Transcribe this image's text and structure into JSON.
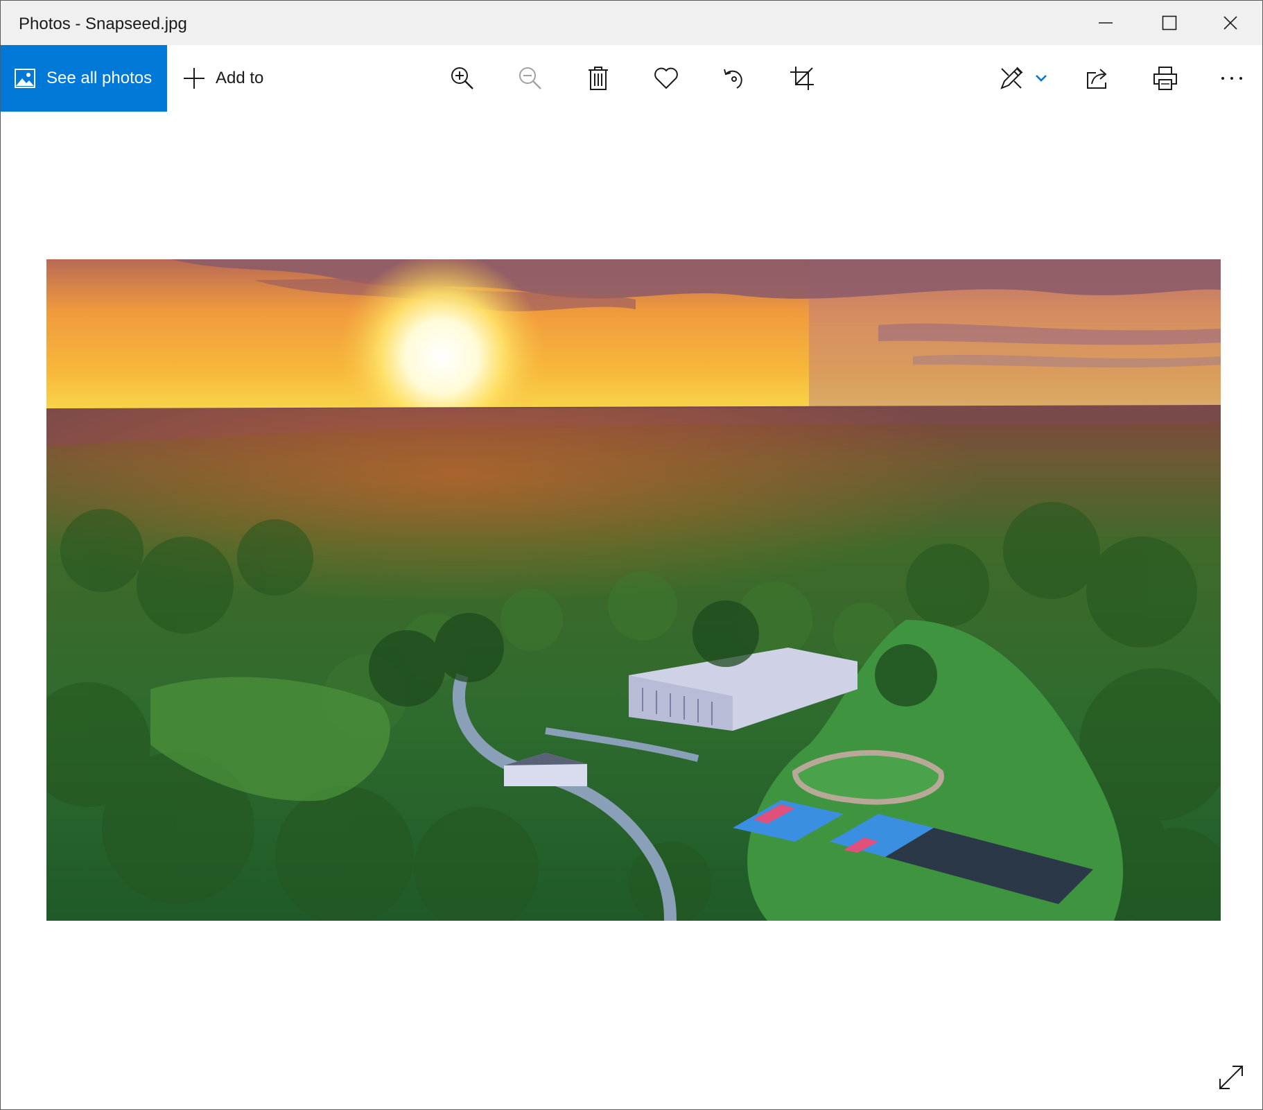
{
  "window": {
    "title": "Photos - Snapseed.jpg",
    "controls": [
      "minimize",
      "maximize",
      "close"
    ]
  },
  "toolbar": {
    "see_all_photos_label": "See all photos",
    "add_to_label": "Add to",
    "icons": [
      "zoom-in-icon",
      "zoom-out-icon",
      "delete-icon",
      "favorite-heart-icon",
      "rotate-icon",
      "crop-icon",
      "edit-create-icon",
      "chevron-down-icon",
      "share-icon",
      "print-icon",
      "more-options-icon"
    ],
    "zoom_out_enabled": false,
    "accent_color": "#0078d7"
  },
  "viewer": {
    "photo_subject": "aerial-sunset-landscape",
    "expand_icon": "fullscreen-expand-icon"
  }
}
